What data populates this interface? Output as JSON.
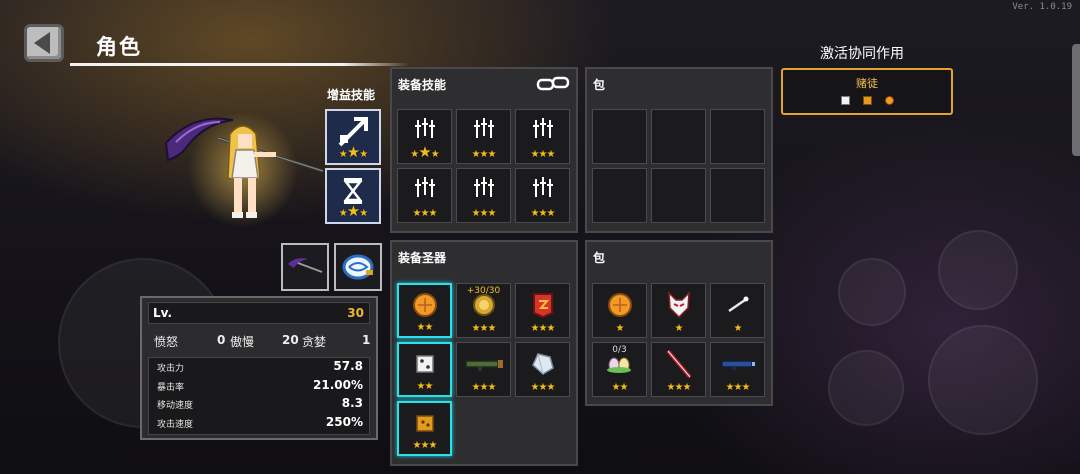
{
  "version": "Ver. 1.0.19",
  "header": {
    "title": "角色"
  },
  "buff_skills": {
    "label": "增益技能",
    "items": [
      {
        "icon": "stat-up-icon",
        "stars": "★★★",
        "big_star_index": 1
      },
      {
        "icon": "hourglass-icon",
        "stars": "★★★",
        "big_star_index": 1
      }
    ]
  },
  "weapons": [
    {
      "icon": "scythe-icon"
    },
    {
      "icon": "cyclone-icon"
    }
  ],
  "stats": {
    "lv_label": "Lv.",
    "lv_value": "30",
    "attributes": [
      {
        "name": "愤怒",
        "value": "0"
      },
      {
        "name": "傲慢",
        "value": "20"
      },
      {
        "name": "贪婪",
        "value": "1"
      }
    ],
    "table": [
      {
        "key": "攻击力",
        "value": "57.8"
      },
      {
        "key": "暴击率",
        "value": "21.00%"
      },
      {
        "key": "移动速度",
        "value": "8.3"
      },
      {
        "key": "攻击速度",
        "value": "250%"
      }
    ]
  },
  "equip_skills": {
    "title": "装备技能",
    "slots": [
      {
        "icon": "sword-rain-icon",
        "stars": "★★★",
        "big": true
      },
      {
        "icon": "sword-rain-icon",
        "stars": "★★★",
        "big": false
      },
      {
        "icon": "sword-rain-icon",
        "stars": "★★★",
        "big": false
      },
      {
        "icon": "sword-rain-icon",
        "stars": "★★★",
        "big": false
      },
      {
        "icon": "sword-rain-icon",
        "stars": "★★★",
        "big": false
      },
      {
        "icon": "sword-rain-icon",
        "stars": "★★★",
        "big": false
      }
    ]
  },
  "bag_top": {
    "title": "包",
    "slots": 6
  },
  "equip_relics": {
    "title": "装备圣器",
    "slots": [
      {
        "icon": "orange-orb-icon",
        "stars": "★★",
        "label": "",
        "cyan": true
      },
      {
        "icon": "gold-medal-icon",
        "stars": "★★★",
        "label": "+30/30",
        "cyan": false
      },
      {
        "icon": "red-banner-icon",
        "stars": "★★★",
        "label": "",
        "cyan": false
      },
      {
        "icon": "dice-icon",
        "stars": "★★",
        "label": "",
        "cyan": true
      },
      {
        "icon": "bazooka-icon",
        "stars": "★★★",
        "label": "",
        "cyan": false
      },
      {
        "icon": "crystal-icon",
        "stars": "★★★",
        "label": "",
        "cyan": false
      },
      {
        "icon": "gold-box-icon",
        "stars": "★★★",
        "label": "",
        "cyan": true
      }
    ]
  },
  "bag_bottom": {
    "title": "包",
    "slots": [
      {
        "icon": "orange-orb-icon",
        "stars": "★",
        "label": ""
      },
      {
        "icon": "fox-mask-icon",
        "stars": "★",
        "label": ""
      },
      {
        "icon": "bone-wand-icon",
        "stars": "★",
        "label": ""
      },
      {
        "icon": "eggs-icon",
        "stars": "★★",
        "label": "0/3"
      },
      {
        "icon": "blood-sword-icon",
        "stars": "★★★",
        "label": ""
      },
      {
        "icon": "blue-gun-icon",
        "stars": "★★★",
        "label": ""
      }
    ]
  },
  "synergy": {
    "title": "激活协同作用",
    "name": "赌徒",
    "icons": [
      "dice-icon",
      "gold-box-icon",
      "orange-orb-icon"
    ]
  },
  "colors": {
    "star": "#f2bc1c",
    "accent": "#e2a42c",
    "cyan": "#2be0e8"
  }
}
